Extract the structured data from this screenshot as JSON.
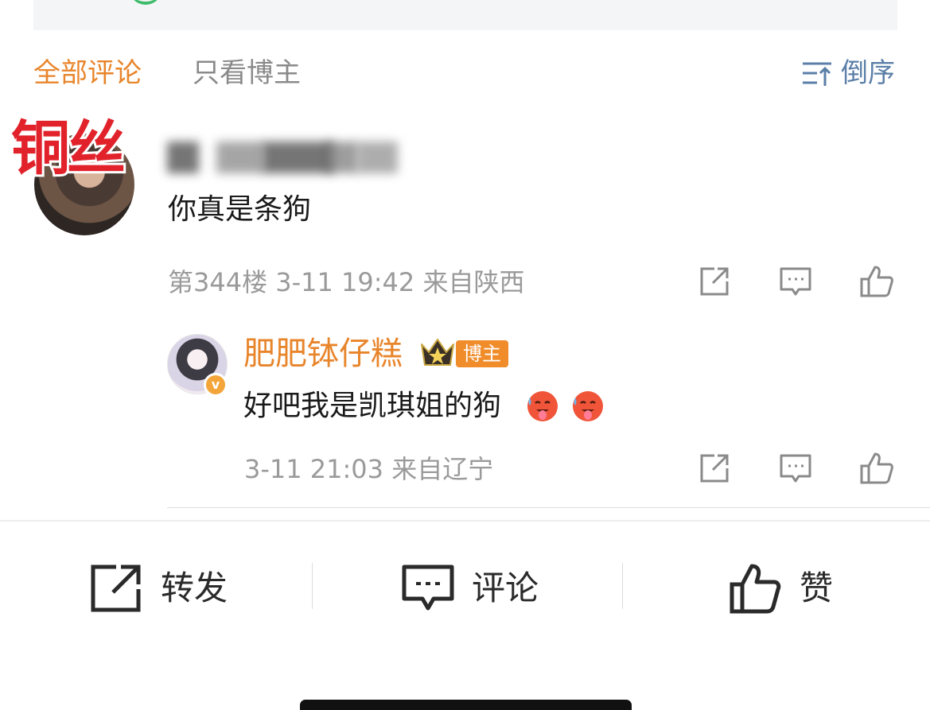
{
  "tabs": {
    "all_comments": "全部评论",
    "blogger_only": "只看博主",
    "sort": "倒序"
  },
  "overlay_tag": "铜丝",
  "comment": {
    "text": "你真是条狗",
    "meta": "第344楼 3-11 19:42 来自陕西"
  },
  "reply": {
    "author": "肥肥钵仔糕",
    "badge": "博主",
    "verify_mark": "v",
    "text": "好吧我是凯琪姐的狗",
    "emojis": [
      "hot-face-emoji",
      "hot-face-emoji"
    ],
    "meta": "3-11 21:03 来自辽宁"
  },
  "bottom_bar": {
    "repost": "转发",
    "comment": "评论",
    "like": "赞"
  },
  "colors": {
    "accent_orange": "#e8852b",
    "sort_blue": "#5b7fa8",
    "overlay_red": "#e1222b",
    "meta_gray": "#9a9a9a"
  }
}
